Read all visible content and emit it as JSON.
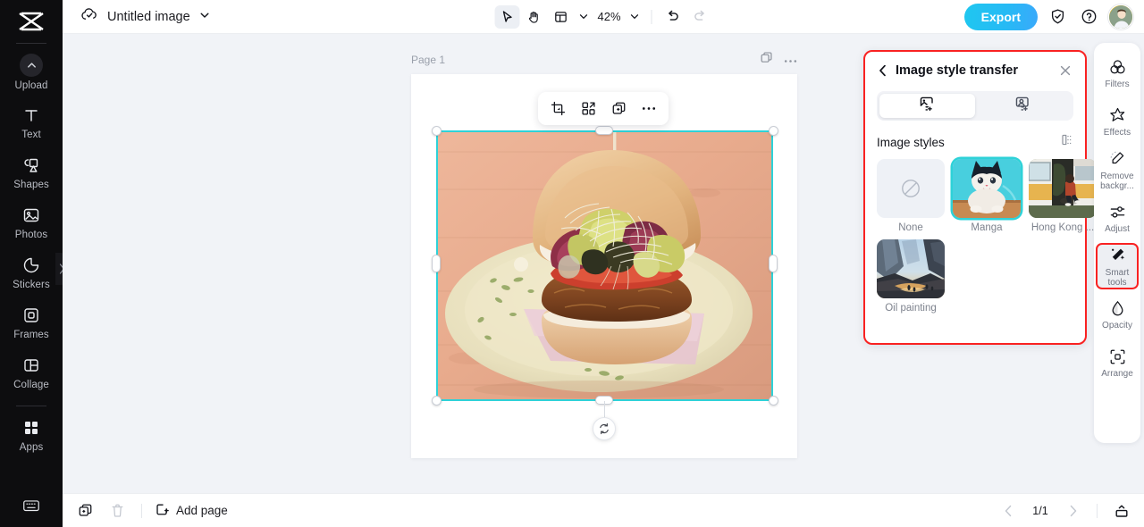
{
  "sidebar": {
    "logo_name": "capcut-logo",
    "items": [
      {
        "label": "Upload",
        "icon": "upload-icon"
      },
      {
        "label": "Text",
        "icon": "text-icon"
      },
      {
        "label": "Shapes",
        "icon": "shapes-icon"
      },
      {
        "label": "Photos",
        "icon": "photos-icon"
      },
      {
        "label": "Stickers",
        "icon": "stickers-icon"
      },
      {
        "label": "Frames",
        "icon": "frames-icon"
      },
      {
        "label": "Collage",
        "icon": "collage-icon"
      },
      {
        "label": "Apps",
        "icon": "apps-icon"
      }
    ],
    "bottom_icon": "keyboard-icon"
  },
  "topbar": {
    "cloud_icon": "cloud-saved-icon",
    "title": "Untitled image",
    "title_chevron": "chevron-down-icon",
    "tools": [
      {
        "name": "select-tool",
        "icon": "cursor-icon",
        "active": true
      },
      {
        "name": "hand-tool",
        "icon": "hand-icon",
        "active": false
      },
      {
        "name": "layout-tool",
        "icon": "layout-icon",
        "active": false
      }
    ],
    "zoom_level": "42%",
    "undo_icon": "undo-icon",
    "redo_icon": "redo-icon",
    "export_label": "Export",
    "shield_icon": "shield-check-icon",
    "help_icon": "help-circle-icon",
    "avatar_name": "user-avatar"
  },
  "canvas": {
    "page_label": "Page 1",
    "duplicate_page_icon": "duplicate-page-icon",
    "more_icon": "more-horizontal-icon",
    "float_toolbar": [
      {
        "name": "crop-button",
        "icon": "crop-icon"
      },
      {
        "name": "cutout-button",
        "icon": "cutout-icon"
      },
      {
        "name": "duplicate-button",
        "icon": "duplicate-icon"
      },
      {
        "name": "more-button",
        "icon": "more-horizontal-icon"
      }
    ],
    "rotate_icon": "rotate-icon",
    "selection_color": "#2ed2d8"
  },
  "style_panel": {
    "back_icon": "chevron-left-icon",
    "title": "Image style transfer",
    "close_icon": "close-icon",
    "tabs": [
      {
        "name": "tab-image-style",
        "icon": "image-style-icon",
        "active": true
      },
      {
        "name": "tab-portrait-style",
        "icon": "portrait-style-icon",
        "active": false
      }
    ],
    "section_title": "Image styles",
    "section_icon": "compare-icon",
    "highlight_color": "#f92222",
    "styles": [
      {
        "label": "None",
        "thumb": "none-thumb",
        "selected": false
      },
      {
        "label": "Manga",
        "thumb": "manga-cat-thumb",
        "selected": true
      },
      {
        "label": "Hong Kong ...",
        "thumb": "hongkong-van-thumb",
        "selected": false
      },
      {
        "label": "Oil painting",
        "thumb": "oil-painting-thumb",
        "selected": false
      }
    ]
  },
  "right_rail": {
    "items": [
      {
        "label": "Filters",
        "icon": "filters-icon",
        "highlighted": false
      },
      {
        "label": "Effects",
        "icon": "effects-icon",
        "highlighted": false
      },
      {
        "label": "Remove backgr...",
        "icon": "remove-background-icon",
        "highlighted": false
      },
      {
        "label": "Adjust",
        "icon": "adjust-icon",
        "highlighted": false
      },
      {
        "label": "Smart tools",
        "icon": "smart-tools-icon",
        "highlighted": true
      },
      {
        "label": "Opacity",
        "icon": "opacity-icon",
        "highlighted": false
      },
      {
        "label": "Arrange",
        "icon": "arrange-icon",
        "highlighted": false
      }
    ]
  },
  "bottombar": {
    "duplicate_icon": "duplicate-page-icon",
    "delete_icon": "trash-icon",
    "add_page_icon": "add-page-icon",
    "add_page_label": "Add page",
    "prev_icon": "chevron-left-icon",
    "page_indicator": "1/1",
    "next_icon": "chevron-right-icon",
    "present_icon": "present-icon"
  }
}
